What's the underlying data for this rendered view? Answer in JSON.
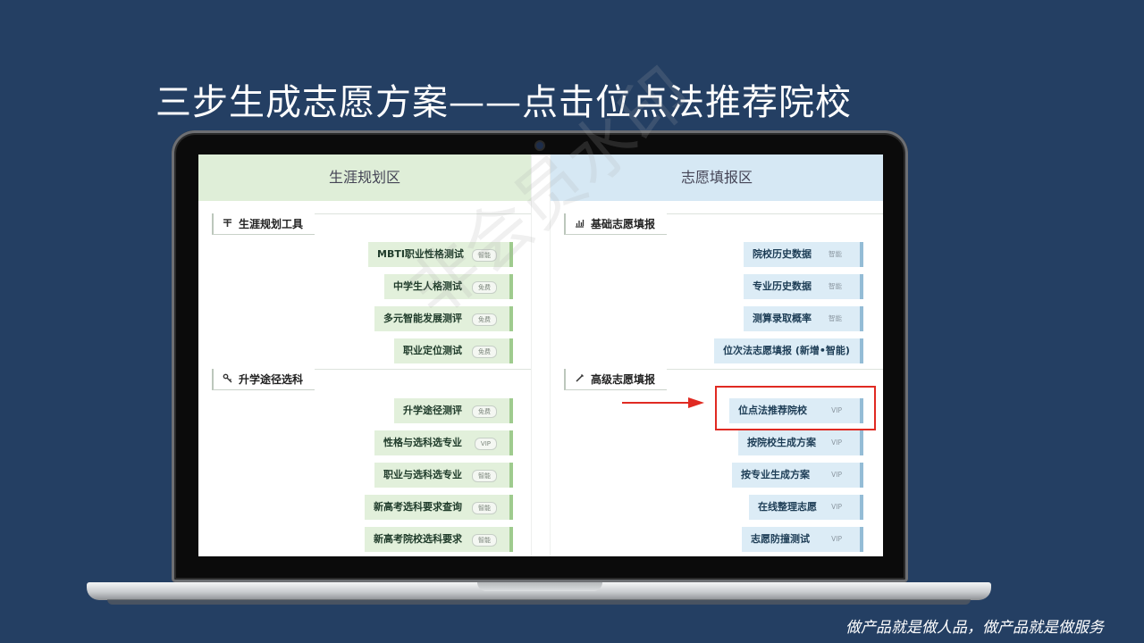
{
  "slide": {
    "title": "三步生成志愿方案——点击位点法推荐院校",
    "footer": "做产品就是做人品，做产品就是做服务"
  },
  "watermark": "非会员水印",
  "left_panel": {
    "header": "生涯规划区",
    "sections": [
      {
        "label": "生涯规划工具",
        "icon": "signpost-icon",
        "items": [
          {
            "label": "MBTI职业性格测试",
            "badge": "智能"
          },
          {
            "label": "中学生人格测试",
            "badge": "免费"
          },
          {
            "label": "多元智能发展测评",
            "badge": "免费"
          },
          {
            "label": "职业定位测试",
            "badge": "免费"
          }
        ]
      },
      {
        "label": "升学途径选科",
        "icon": "key-icon",
        "items": [
          {
            "label": "升学途径测评",
            "badge": "免费"
          },
          {
            "label": "性格与选科选专业",
            "badge": "VIP"
          },
          {
            "label": "职业与选科选专业",
            "badge": "智能"
          },
          {
            "label": "新高考选科要求查询",
            "badge": "智能"
          },
          {
            "label": "新高考院校选科要求",
            "badge": "智能"
          }
        ]
      }
    ]
  },
  "right_panel": {
    "header": "志愿填报区",
    "sections": [
      {
        "label": "基础志愿填报",
        "icon": "bar-chart-icon",
        "items": [
          {
            "label": "院校历史数据",
            "badge": "智能"
          },
          {
            "label": "专业历史数据",
            "badge": "智能"
          },
          {
            "label": "测算录取概率",
            "badge": "智能"
          },
          {
            "label": "位次法志愿填报  (新增•智能)",
            "badge": ""
          }
        ]
      },
      {
        "label": "高级志愿填报",
        "icon": "pencil-icon",
        "items": [
          {
            "label": "位点法推荐院校",
            "badge": "VIP"
          },
          {
            "label": "按院校生成方案",
            "badge": "VIP"
          },
          {
            "label": "按专业生成方案",
            "badge": "VIP"
          },
          {
            "label": "在线整理志愿",
            "badge": "VIP"
          },
          {
            "label": "志愿防撞测试",
            "badge": "VIP"
          }
        ]
      }
    ]
  },
  "colors": {
    "background": "#243f63",
    "left_accent": "#9fcb8e",
    "right_accent": "#94bcd6",
    "highlight": "#e02a22"
  }
}
